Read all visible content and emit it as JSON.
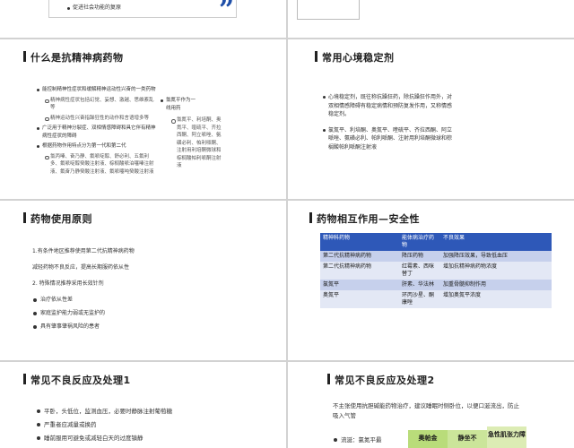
{
  "slide0": {
    "bullet": "促进社会功能的复原"
  },
  "slide2": {
    "title": "什么是抗精神病药物",
    "col1": [
      {
        "text": "能控制精神性症状和缓解精神运动性兴奋的一类药物",
        "sub": false
      },
      {
        "text": "精神病性症状包括幻觉、妄想、激越、思维紊乱等",
        "sub": true
      },
      {
        "text": "精神运动性兴奋指躁狂性的动作和言语增多等",
        "sub": true
      },
      {
        "text": "广泛用于精神分裂症、双相情感障碍和具它伴有精神病性症状的障碍",
        "sub": false
      },
      {
        "text": "根据药物作用特点分为第一代和第二代",
        "sub": false
      },
      {
        "text": "氯丙嗪、奋乃静、氟哌啶醇、舒必利、五氟利多、氟哌啶醇癸酸注射液、棕榈酸哌泊噻嗪注射液、氟奋乃静癸酸注射液、氟哌噻吨癸酸注射液",
        "sub": true
      }
    ],
    "col2_top": "氯氮平作为一线用药",
    "col2": "氯氮平、利培酮、奥氮平、喹硫平、齐拉西酮、阿立哌唑、氨磺必利、帕利哌酮、注射用利培酮微球和棕榈酸帕利哌酮注射液"
  },
  "slide3": {
    "title": "常用心境稳定剂",
    "bullets": [
      "心境稳定剂，既往称抗躁狂药，除抗躁狂作用外，对双相情感障碍有稳定病情和预防复发作用，又称情感稳定剂。",
      "氯氮平、利培酮、奥氮平、喹硫平、齐拉西酮、阿立哌唑、氨磺必利、帕利哌酮、注射用利培酮微球和棕榈酸帕利哌酮注射液"
    ]
  },
  "slide4": {
    "title": "药物使用原则",
    "line1": "1.有条件地区推荐使用第二代抗精神病药物",
    "line2": "减轻药物不良反应，提高长期服药依从性",
    "line3": "2. 特殊情况推荐采用长效针剂",
    "bullets": [
      "治疗依从性差",
      "家庭监护能力弱或无监护的",
      "具有肇事肇祸风险的患者"
    ]
  },
  "slide5": {
    "title": "药物相互作用—安全性",
    "headers": [
      "精神科药物",
      "能体病治疗药物",
      "不良效果"
    ],
    "rows": [
      [
        "第二代抗精神病药物",
        "降压药物",
        "加强降压效果，导致低血压"
      ],
      [
        "第二代抗精神病药物",
        "红霉素、西咪替丁",
        "增加抗精神病药物浓度"
      ],
      [
        "氯氮平",
        "肝素、华法林",
        "加重骨髓抑制作用"
      ],
      [
        "奥氮平",
        "环丙沙星、酮康唑",
        "增加奥氮平浓度"
      ]
    ]
  },
  "slide6": {
    "title": "常见不良反应及处理1",
    "bullets": [
      "平卧，头低位，监测血压，必要时静脉注射葡萄糖",
      "严重者应减量或换药",
      "睡前服用可避免或减轻白天的过度镇静"
    ]
  },
  "slide7": {
    "title": "常见不良反应及处理2",
    "para": "不主张使用抗胆碱能药物治疗，建议睡眠时侧卧位，以便口涎流出，防止吸入气管",
    "bullet": "流涎：氯氮平最",
    "tags": [
      "奥帕金",
      "静坐不",
      "急性肌张力障"
    ],
    "tag_colors": [
      "#b9dc7a",
      "#cbe59a",
      "#dcecb4"
    ]
  }
}
